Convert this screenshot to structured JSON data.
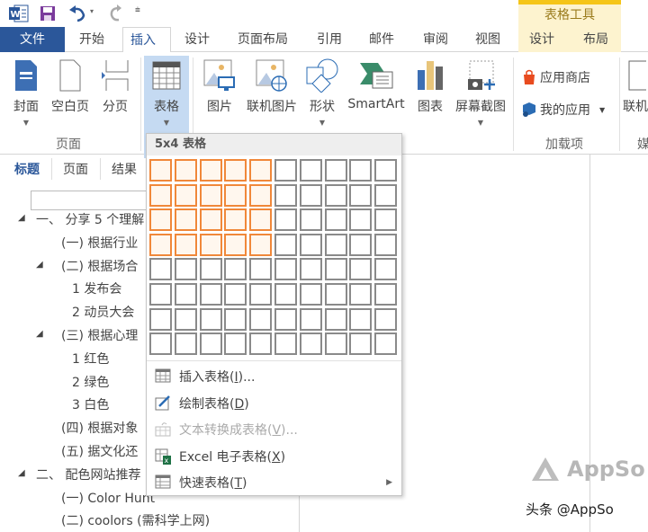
{
  "quick_access": {
    "app_icon": "word-icon",
    "save": "save-icon",
    "undo": "undo-icon",
    "redo": "redo-icon",
    "customize": "customize-icon"
  },
  "context_header": "表格工具",
  "tabs": [
    "文件",
    "开始",
    "插入",
    "设计",
    "页面布局",
    "引用",
    "邮件",
    "审阅",
    "视图"
  ],
  "context_tabs": [
    "设计",
    "布局"
  ],
  "ribbon": {
    "pages_group": {
      "label": "页面",
      "buttons": [
        "封面",
        "空白页",
        "分页"
      ]
    },
    "table_button": "表格",
    "illustrations": [
      "图片",
      "联机图片",
      "形状",
      "SmartArt",
      "图表",
      "屏幕截图"
    ],
    "addins_group": {
      "label": "加载项",
      "store": "应用商店",
      "my_apps": "我的应用"
    },
    "media_partial": {
      "button": "联机",
      "label": "媒"
    }
  },
  "table_dropdown": {
    "header": "5x4 表格",
    "grid_cols": 10,
    "grid_rows": 8,
    "selected_cols": 5,
    "selected_rows": 4,
    "items": [
      {
        "label": "插入表格(",
        "key": "I",
        "suffix": ")...",
        "icon": "insert-table-icon",
        "disabled": false
      },
      {
        "label": "绘制表格(",
        "key": "D",
        "suffix": ")",
        "icon": "draw-table-icon",
        "disabled": false
      },
      {
        "label": "文本转换成表格(",
        "key": "V",
        "suffix": ")...",
        "icon": "text-to-table-icon",
        "disabled": true
      },
      {
        "label": "Excel 电子表格(",
        "key": "X",
        "suffix": ")",
        "icon": "excel-icon",
        "disabled": false
      },
      {
        "label": "快速表格(",
        "key": "T",
        "suffix": ")",
        "icon": "quick-table-icon",
        "disabled": false
      }
    ]
  },
  "nav_pane": {
    "tabs": [
      "标题",
      "页面",
      "结果"
    ],
    "search_value": "",
    "tree": [
      {
        "text": "一、 分享 5 个理解",
        "level": 0,
        "arrow": true
      },
      {
        "text": "(一)  根据行业",
        "level": 1,
        "arrow": false
      },
      {
        "text": "(二)  根据场合",
        "level": 1,
        "arrow": true
      },
      {
        "text": "1 发布会",
        "level": 2,
        "arrow": false
      },
      {
        "text": "2 动员大会",
        "level": 2,
        "arrow": false
      },
      {
        "text": "(三)  根据心理",
        "level": 1,
        "arrow": true
      },
      {
        "text": "1 红色",
        "level": 2,
        "arrow": false
      },
      {
        "text": "2 绿色",
        "level": 2,
        "arrow": false
      },
      {
        "text": "3 白色",
        "level": 2,
        "arrow": false
      },
      {
        "text": "(四)  根据对象",
        "level": 1,
        "arrow": false
      },
      {
        "text": "(五)  据文化还",
        "level": 1,
        "arrow": false
      },
      {
        "text": "二、 配色网站推荐",
        "level": 0,
        "arrow": true
      },
      {
        "text": "(一)  Color Hunt",
        "level": 1,
        "arrow": false
      },
      {
        "text": "(二)  coolors  (需科学上网)",
        "level": 1,
        "arrow": false
      }
    ]
  },
  "watermark": {
    "logo": "AppSo",
    "credit": "头条 @AppSo"
  }
}
